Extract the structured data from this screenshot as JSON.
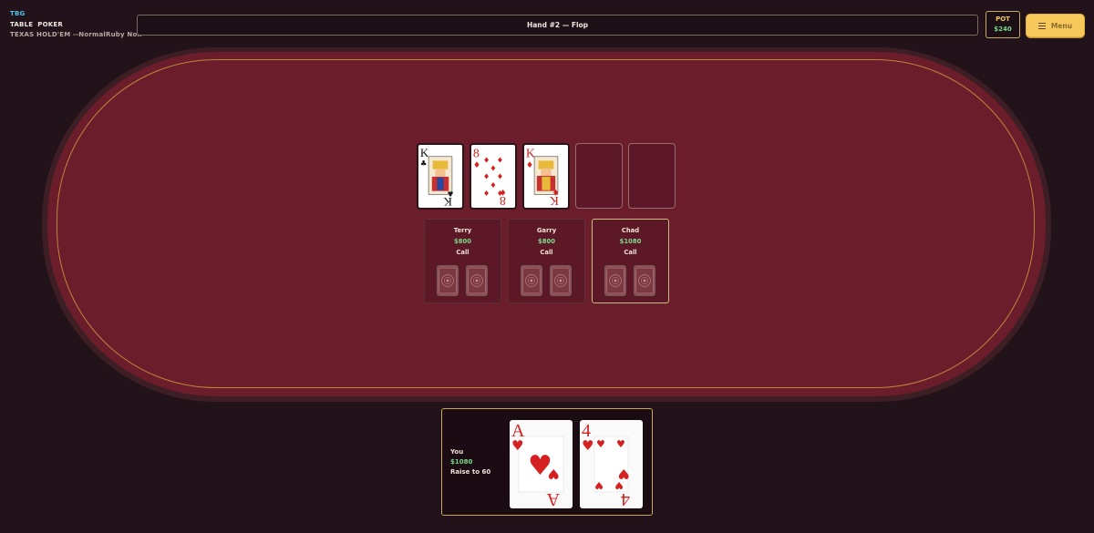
{
  "header": {
    "brand_tag": "TBG",
    "table_word": "TABLE",
    "game_word": "POKER",
    "subtitle": "TEXAS HOLD'EM --NormalRuby Noir",
    "status": "Hand #2 — Flop",
    "pot_label": "POT",
    "pot_amount": "$240",
    "menu_label": "Menu"
  },
  "board": {
    "cards": [
      {
        "rank": "K",
        "suit": "spades",
        "symbol": "♣",
        "color": "#111111"
      },
      {
        "rank": "8",
        "suit": "diamonds",
        "symbol": "♦",
        "color": "#d42020"
      },
      {
        "rank": "K",
        "suit": "diamonds",
        "symbol": "♦",
        "color": "#d42020"
      }
    ],
    "empty_slots": 2
  },
  "players": [
    {
      "name": "Terry",
      "chips": "$800",
      "action": "Call",
      "active": false
    },
    {
      "name": "Garry",
      "chips": "$800",
      "action": "Call",
      "active": false
    },
    {
      "name": "Chad",
      "chips": "$1080",
      "action": "Call",
      "active": true
    }
  ],
  "hero": {
    "name": "You",
    "chips": "$1080",
    "action": "Raise to 60",
    "cards": [
      {
        "rank": "A",
        "suit": "hearts",
        "symbol": "♥",
        "color": "#d42020"
      },
      {
        "rank": "4",
        "suit": "hearts",
        "symbol": "♥",
        "color": "#d42020"
      }
    ]
  },
  "colors": {
    "felt": "#6b1d2b",
    "rail": "#3c1e24",
    "accent_gold": "#f7c95a",
    "chips_green": "#7ed88c"
  }
}
